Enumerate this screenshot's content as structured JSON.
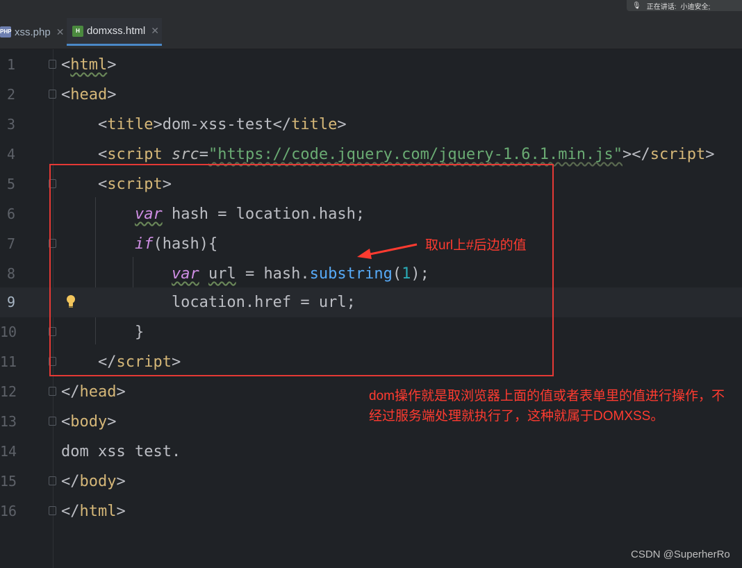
{
  "tabs": [
    {
      "label": "xss.php",
      "icon": "php-file-icon",
      "active": false
    },
    {
      "label": "domxss.html",
      "icon": "html-file-icon",
      "active": true
    }
  ],
  "overlay": {
    "label": "正在讲话:",
    "speaker": "小迪安全;"
  },
  "line_numbers": [
    "1",
    "2",
    "3",
    "4",
    "5",
    "6",
    "7",
    "8",
    "9",
    "10",
    "11",
    "12",
    "13",
    "14",
    "15",
    "16"
  ],
  "code": {
    "title_text": "dom-xss-test",
    "script_src": "\"https://code.jquery.com/jquery-1.6.1.min.js\"",
    "body_text": "dom xss test."
  },
  "annotations": {
    "arrow_note": "取url上#后边的值",
    "explanation": "dom操作就是取浏览器上面的值或者表单里的值进行操作，不经过服务端处理就执行了，这种就属于DOMXSS。"
  },
  "watermark": "CSDN @SuperherRo",
  "colors": {
    "annotation": "#ff3b30",
    "box": "#e53935"
  }
}
